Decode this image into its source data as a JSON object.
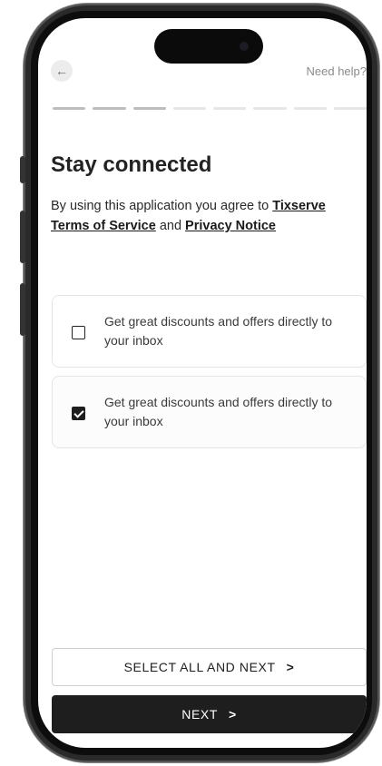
{
  "header": {
    "back_icon": "←",
    "help_label": "Need help?"
  },
  "progress": {
    "total_steps": 8,
    "completed_steps": 3
  },
  "content": {
    "title": "Stay connected",
    "intro_prefix": "By using this application you agree to ",
    "terms_link": "Tixserve Terms of Service",
    "intro_and": " and ",
    "privacy_link": "Privacy Notice"
  },
  "options": [
    {
      "label": "Get great discounts and offers directly to your inbox",
      "checked": false
    },
    {
      "label": "Get great discounts and offers directly to your inbox",
      "checked": true
    }
  ],
  "buttons": {
    "select_all_label": "SELECT ALL AND NEXT",
    "next_label": "NEXT",
    "chevron_glyph": ">"
  }
}
